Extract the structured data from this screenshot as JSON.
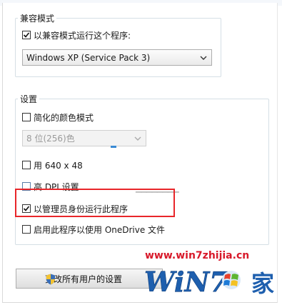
{
  "compat_group": {
    "title": "兼容模式",
    "checkbox_label": "以兼容模式运行这个程序:",
    "checked": true,
    "os_select_value": "Windows XP (Service Pack 3)"
  },
  "settings_group": {
    "title": "设置",
    "reduced_color_label": "简化的颜色模式",
    "color_select_value": "8 位(256)色",
    "resolution_label": "用 640 x 48",
    "dpi_label": "高 DPI 设置",
    "admin_label": "以管理员身份运行此程序",
    "onedrive_label": "启用此程序以使用 OneDrive 文件"
  },
  "all_users_button": "更改所有用户的设置",
  "watermark": {
    "url": "www.win7zhijia.cn",
    "logo_text": "WiN7",
    "logo_suffix": "家"
  },
  "colors": {
    "highlight": "#e8262a",
    "watermark_red": "#d8192a",
    "logo_blue": "#1e5fae"
  }
}
